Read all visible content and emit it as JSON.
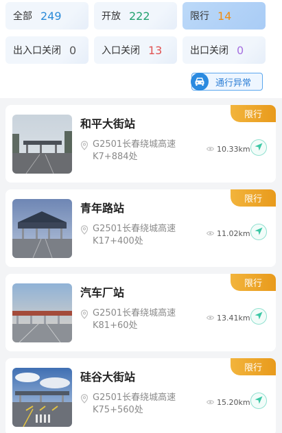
{
  "filters": {
    "row1": [
      {
        "label": "全部",
        "count": "249",
        "color": "#2a8ad8",
        "active": false
      },
      {
        "label": "开放",
        "count": "222",
        "color": "#22a16e",
        "active": false
      },
      {
        "label": "限行",
        "count": "14",
        "color": "#f08c0f",
        "active": true
      }
    ],
    "row2": [
      {
        "label": "出入口关闭",
        "count": "0",
        "color": "#555555"
      },
      {
        "label": "入口关闭",
        "count": "13",
        "color": "#e05252"
      },
      {
        "label": "出口关闭",
        "count": "0",
        "color": "#a671e0"
      }
    ]
  },
  "anomaly_button": {
    "label": "通行异常",
    "icon": "car-icon"
  },
  "stations": [
    {
      "name": "和平大街站",
      "badge": "限行",
      "address": "G2501长春绕城高速K7+884处",
      "distance": "10.33km"
    },
    {
      "name": "青年路站",
      "badge": "限行",
      "address": "G2501长春绕城高速K17+400处",
      "distance": "11.02km"
    },
    {
      "name": "汽车厂站",
      "badge": "限行",
      "address": "G2501长春绕城高速K81+60处",
      "distance": "13.41km"
    },
    {
      "name": "硅谷大街站",
      "badge": "限行",
      "address": "G2501长春绕城高速K75+560处",
      "distance": "15.20km"
    }
  ]
}
